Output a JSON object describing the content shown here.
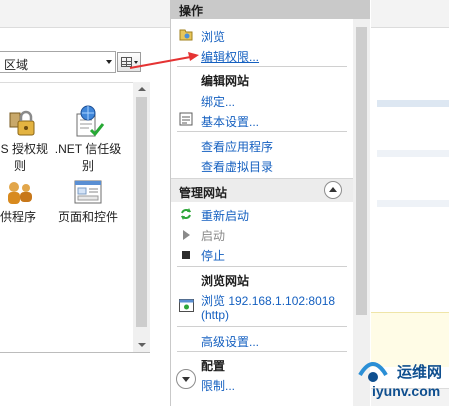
{
  "left_pane": {
    "group_by_value": "区域",
    "features": [
      {
        "label_line1": "...",
        "label_line2": "",
        "icon": "partial-icon"
      },
      {
        "label_line1": "IIS 授权规",
        "label_line2": "则",
        "icon": "lock-users-icon"
      },
      {
        "label_line1": ".NET 信任级",
        "label_line2": "别",
        "icon": "net-trust-icon"
      },
      {
        "label_line1": "提供程序",
        "label_line2": "",
        "icon": "providers-icon"
      },
      {
        "label_line1": "页面和控件",
        "label_line2": "",
        "icon": "pages-controls-icon"
      }
    ]
  },
  "actions": {
    "header": "操作",
    "browse": "浏览",
    "edit_permissions": "编辑权限...",
    "edit_site_heading": "编辑网站",
    "bindings": "绑定...",
    "basic_settings": "基本设置...",
    "view_apps": "查看应用程序",
    "view_vdirs": "查看虚拟目录",
    "manage_site_heading": "管理网站",
    "restart": "重新启动",
    "start": "启动",
    "stop": "停止",
    "browse_site_heading": "浏览网站",
    "browse_url_line1": "浏览 192.168.1.102:8018",
    "browse_url_line2": "(http)",
    "advanced_settings": "高级设置...",
    "config_heading": "配置",
    "limits": "限制..."
  },
  "watermark": {
    "line1": "运维网",
    "line2": "iyunv.com"
  },
  "colors": {
    "link": "#1560c0",
    "header_bg": "#c9c9c9",
    "arrow": "#e53333"
  }
}
